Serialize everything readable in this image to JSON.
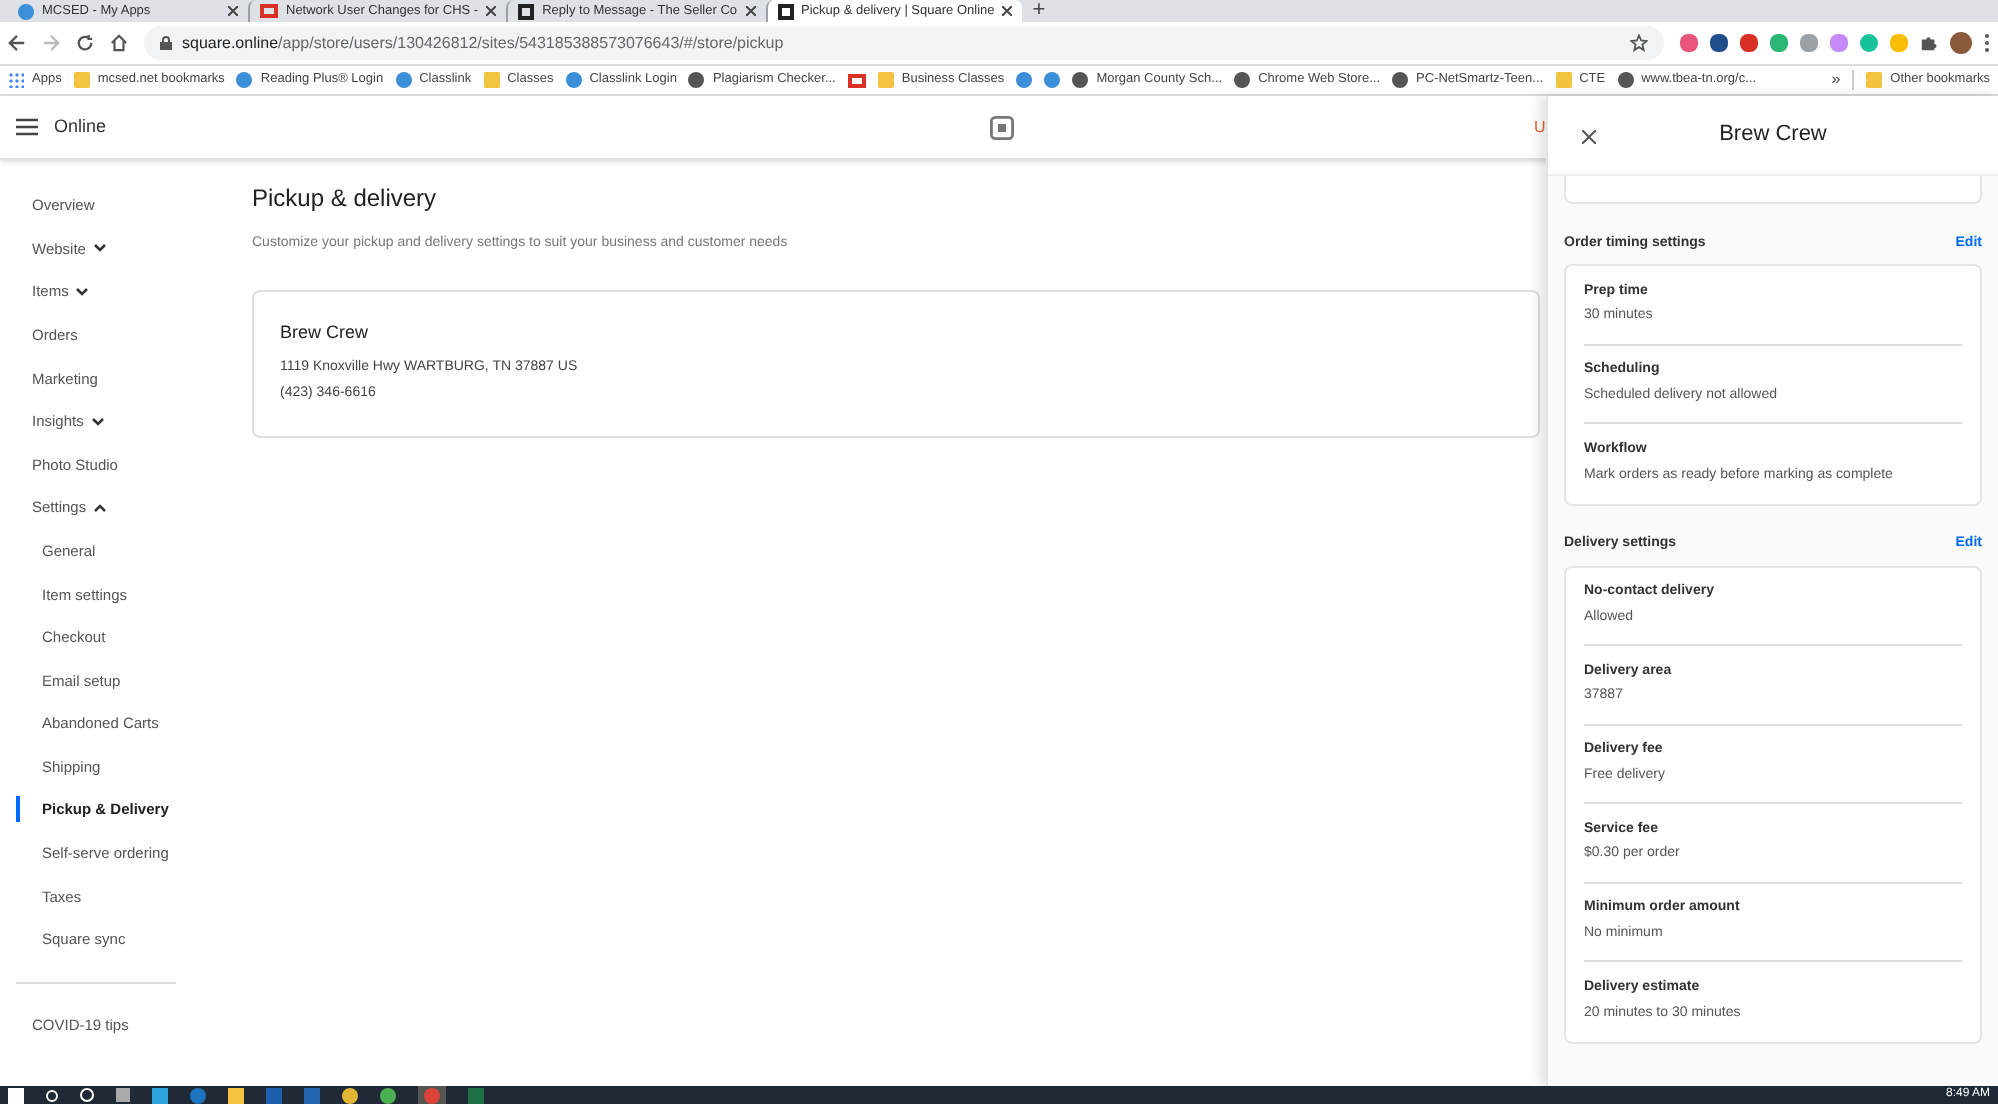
{
  "browser": {
    "tabs": [
      {
        "title": "MCSED - My Apps",
        "kind": "site",
        "selected": false
      },
      {
        "title": "Network User Changes for CHS -",
        "kind": "gmail",
        "selected": false
      },
      {
        "title": "Reply to Message - The Seller Co",
        "kind": "square",
        "selected": false
      },
      {
        "title": "Pickup & delivery | Square Online",
        "kind": "square",
        "selected": true
      }
    ],
    "new_tab": "+",
    "address": {
      "host": "square.online",
      "path": "/app/store/users/130426812/sites/543185388573076643/#/store/pickup"
    },
    "bookmarks": [
      {
        "label": "Apps",
        "kind": "apps"
      },
      {
        "label": "mcsed.net bookmarks",
        "kind": "folder"
      },
      {
        "label": "Reading Plus® Login",
        "kind": "site"
      },
      {
        "label": "Classlink",
        "kind": "site"
      },
      {
        "label": "Classes",
        "kind": "folder"
      },
      {
        "label": "Classlink Login",
        "kind": "site"
      },
      {
        "label": "Plagiarism Checker...",
        "kind": "globe"
      },
      {
        "kind": "gmail"
      },
      {
        "label": "Business Classes",
        "kind": "folder"
      },
      {
        "kind": "site"
      },
      {
        "kind": "site"
      },
      {
        "label": "Morgan County Sch...",
        "kind": "globe"
      },
      {
        "label": "Chrome Web Store...",
        "kind": "globe"
      },
      {
        "label": "PC-NetSmartz-Teen...",
        "kind": "globe"
      },
      {
        "label": "CTE",
        "kind": "folder"
      },
      {
        "label": "www.tbea-tn.org/c...",
        "kind": "globe"
      }
    ],
    "more": "»",
    "other_bookmarks": "Other bookmarks"
  },
  "app": {
    "title": "Online",
    "header_link": "U",
    "sidebar": [
      {
        "label": "Overview",
        "selected": false
      },
      {
        "label": "Website",
        "selected": false,
        "expanded": false
      },
      {
        "label": "Items",
        "selected": false,
        "expanded": false
      },
      {
        "label": "Orders",
        "selected": false
      },
      {
        "label": "Marketing",
        "selected": false
      },
      {
        "label": "Insights",
        "selected": false,
        "expanded": false
      },
      {
        "label": "Photo Studio",
        "selected": false
      },
      {
        "label": "Settings",
        "selected": false,
        "expanded": true,
        "children": [
          {
            "label": "General",
            "selected": false
          },
          {
            "label": "Item settings",
            "selected": false
          },
          {
            "label": "Checkout",
            "selected": false
          },
          {
            "label": "Email setup",
            "selected": false
          },
          {
            "label": "Abandoned Carts",
            "selected": false
          },
          {
            "label": "Shipping",
            "selected": false
          },
          {
            "label": "Pickup & Delivery",
            "selected": true
          },
          {
            "label": "Self-serve ordering",
            "selected": false
          },
          {
            "label": "Taxes",
            "selected": false
          },
          {
            "label": "Square sync",
            "selected": false
          }
        ]
      }
    ],
    "sidebar_footer": {
      "label": "COVID-19 tips",
      "selected": false
    },
    "page": {
      "title": "Pickup & delivery",
      "subtitle": "Customize your pickup and delivery settings to suit your business and customer needs",
      "location": {
        "name": "Brew Crew",
        "address": "1119 Knoxville Hwy WARTBURG, TN 37887 US",
        "phone": "(423) 346-6616"
      }
    }
  },
  "panel": {
    "title": "Brew Crew",
    "sections": [
      {
        "title": "Order timing settings",
        "action": "Edit",
        "rows": [
          {
            "label": "Prep time",
            "value": "30 minutes"
          },
          {
            "label": "Scheduling",
            "value": "Scheduled delivery not allowed"
          },
          {
            "label": "Workflow",
            "value": "Mark orders as ready before marking as complete"
          }
        ]
      },
      {
        "title": "Delivery settings",
        "action": "Edit",
        "rows": [
          {
            "label": "No-contact delivery",
            "value": "Allowed"
          },
          {
            "label": "Delivery area",
            "value": "37887"
          },
          {
            "label": "Delivery fee",
            "value": "Free delivery"
          },
          {
            "label": "Service fee",
            "value": "$0.30 per order"
          },
          {
            "label": "Minimum order amount",
            "value": "No minimum"
          },
          {
            "label": "Delivery estimate",
            "value": "20 minutes to 30 minutes"
          }
        ]
      }
    ]
  },
  "taskbar": {
    "clock": "8:49 AM"
  }
}
